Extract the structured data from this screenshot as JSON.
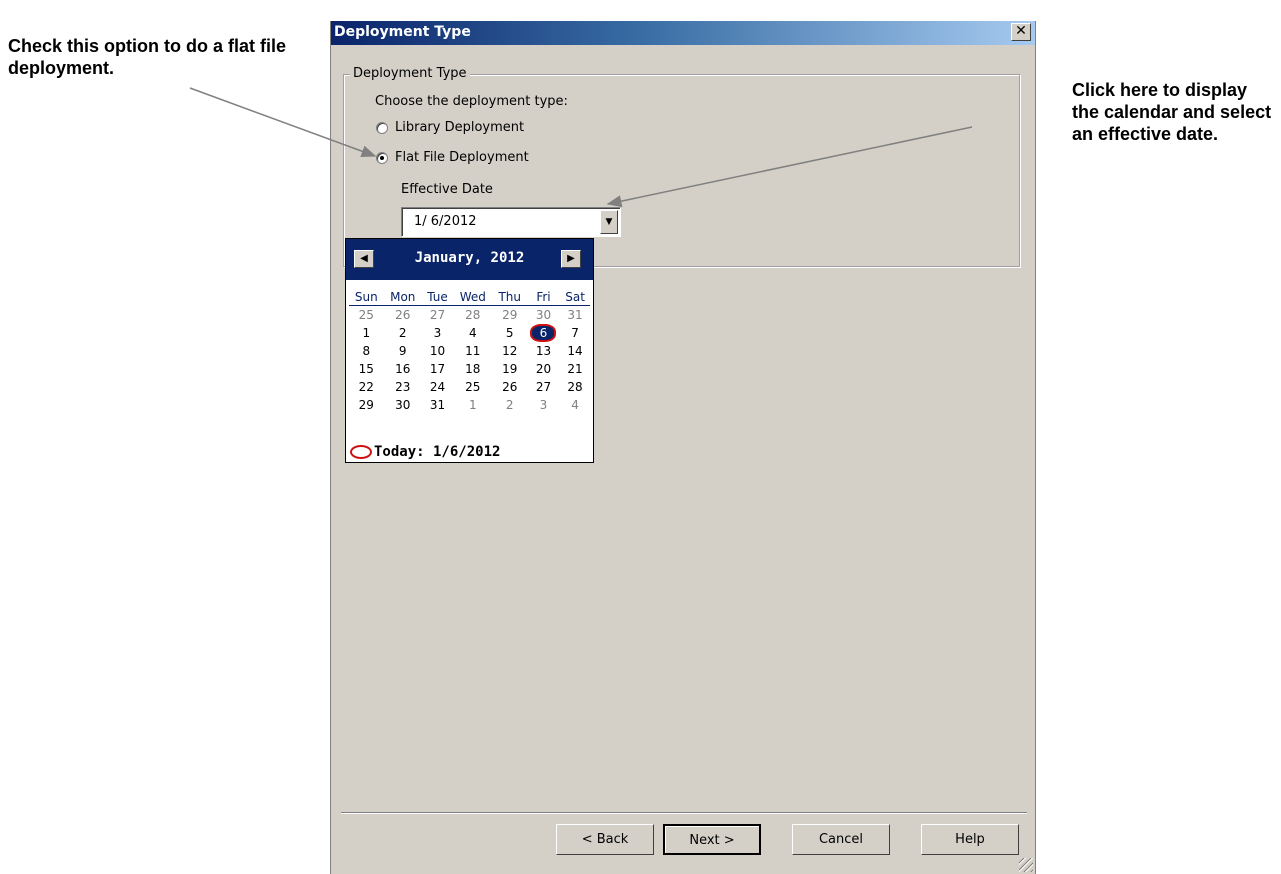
{
  "callouts": {
    "left": "Check this option to do a flat file deployment.",
    "right": "Click here to display the calendar and select an effective date."
  },
  "dialog": {
    "title": "Deployment Type",
    "close_glyph": "✕",
    "group_label": "Deployment Type",
    "prompt": "Choose the deployment type:",
    "options": [
      {
        "label": "Library Deployment",
        "checked": false
      },
      {
        "label": "Flat File Deployment",
        "checked": true
      }
    ],
    "effective_date_label": "Effective Date",
    "effective_date_value": "1/ 6/2012",
    "dropdown_glyph": "▼"
  },
  "calendar": {
    "month_title": "January, 2012",
    "prev_glyph": "◀",
    "next_glyph": "▶",
    "weekdays": [
      "Sun",
      "Mon",
      "Tue",
      "Wed",
      "Thu",
      "Fri",
      "Sat"
    ],
    "weeks": [
      [
        "25",
        "26",
        "27",
        "28",
        "29",
        "30",
        "31"
      ],
      [
        "1",
        "2",
        "3",
        "4",
        "5",
        "6",
        "7"
      ],
      [
        "8",
        "9",
        "10",
        "11",
        "12",
        "13",
        "14"
      ],
      [
        "15",
        "16",
        "17",
        "18",
        "19",
        "20",
        "21"
      ],
      [
        "22",
        "23",
        "24",
        "25",
        "26",
        "27",
        "28"
      ],
      [
        "29",
        "30",
        "31",
        "1",
        "2",
        "3",
        "4"
      ]
    ],
    "selected_day": "6",
    "today_text": "Today: 1/6/2012",
    "colors": {
      "header": "#0a246a",
      "today_circle": "#d01010"
    }
  },
  "buttons": {
    "back": "< Back",
    "next": "Next >",
    "cancel": "Cancel",
    "help": "Help"
  }
}
